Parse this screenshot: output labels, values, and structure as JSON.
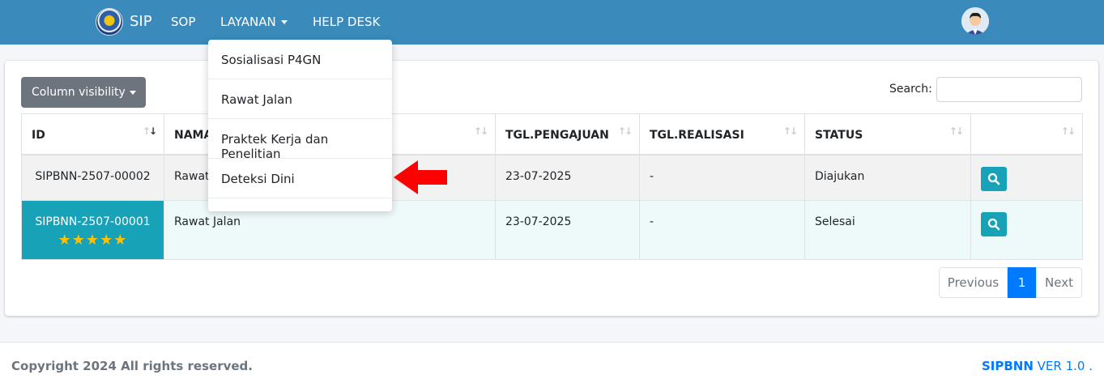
{
  "navbar": {
    "brand": "SIP",
    "menu": [
      "SOP",
      "LAYANAN",
      "HELP DESK"
    ]
  },
  "layanan_dropdown": {
    "items": [
      "Sosialisasi P4GN",
      "Rawat Jalan",
      "Praktek Kerja dan Penelitian",
      "Deteksi Dini"
    ]
  },
  "toolbar": {
    "column_visibility": "Column visibility",
    "search_label": "Search:",
    "search_value": ""
  },
  "table": {
    "headers": [
      "ID",
      "NAMA LAYANAN",
      "TGL.PENGAJUAN",
      "TGL.REALISASI",
      "STATUS",
      ""
    ],
    "rows": [
      {
        "id": "SIPBNN-2507-00002",
        "layanan": "Rawat Jalan",
        "tgl_pengajuan": "23-07-2025",
        "tgl_realisasi": "-",
        "status": "Diajukan",
        "rating": ""
      },
      {
        "id": "SIPBNN-2507-00001",
        "layanan": "Rawat Jalan",
        "tgl_pengajuan": "23-07-2025",
        "tgl_realisasi": "-",
        "status": "Selesai",
        "rating": "★★★★★"
      }
    ]
  },
  "pagination": {
    "previous": "Previous",
    "current": "1",
    "next": "Next"
  },
  "footer": {
    "copyright": "Copyright 2024 All rights reserved.",
    "brand": "SIPBNN",
    "version": "VER 1.0 ."
  },
  "colors": {
    "navbar": "#3a8bbb",
    "teal": "#17a2b8",
    "primary": "#007bff",
    "arrow": "#ff0000",
    "star": "#ffc107"
  }
}
